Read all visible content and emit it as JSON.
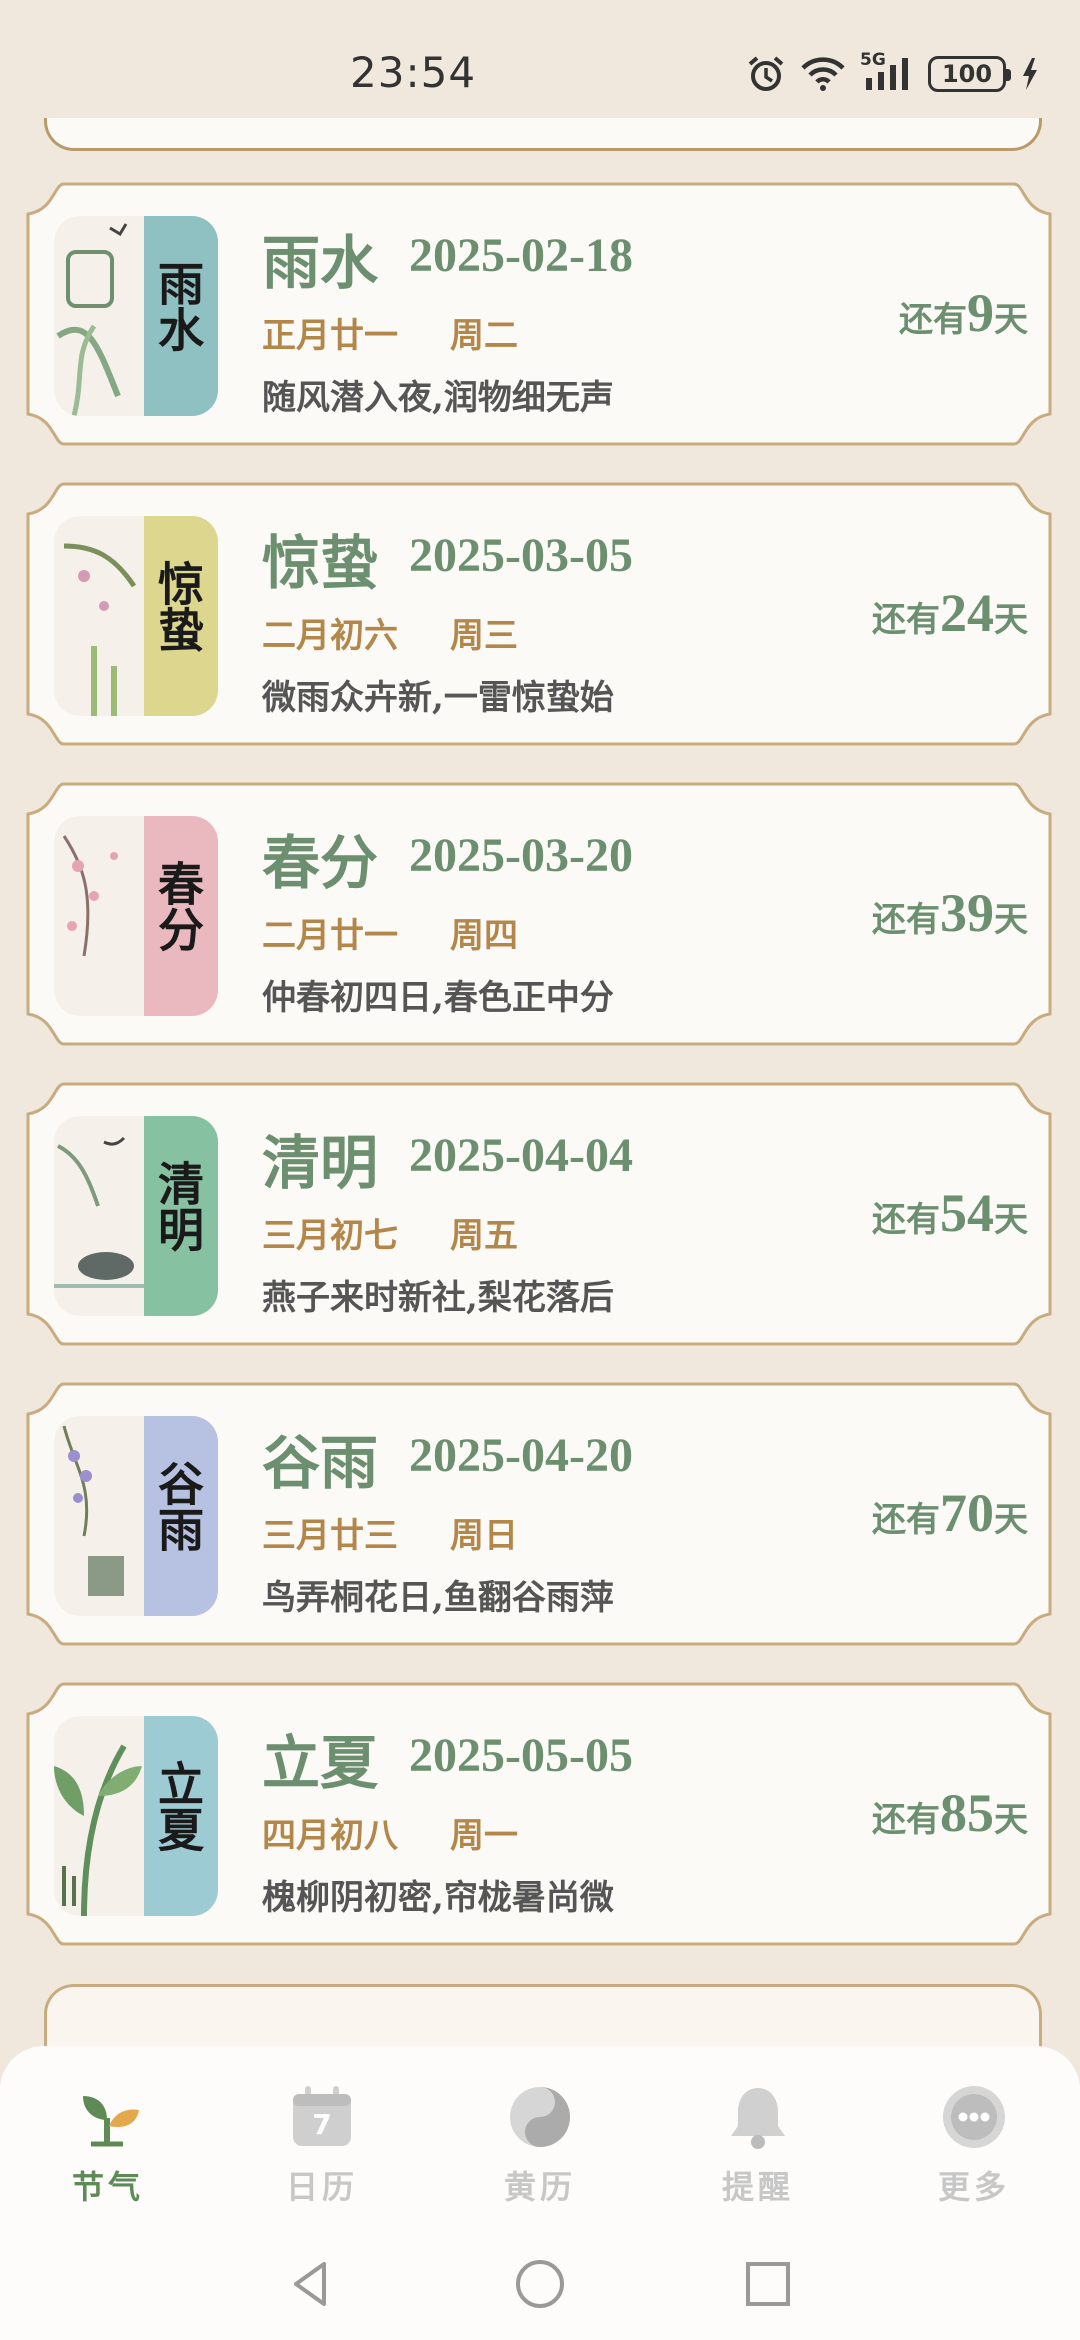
{
  "status": {
    "time": "23:54",
    "battery": "100",
    "network": "5G"
  },
  "terms": [
    {
      "name": "雨水",
      "date": "2025-02-18",
      "lunar": "正月廿一",
      "weekday": "周二",
      "poem": "随风潜入夜,润物细无声",
      "countdown_prefix": "还有",
      "days": "9",
      "countdown_suffix": "天",
      "calligraphy": "雨水",
      "band_color": "#8fc0c2"
    },
    {
      "name": "惊蛰",
      "date": "2025-03-05",
      "lunar": "二月初六",
      "weekday": "周三",
      "poem": "微雨众卉新,一雷惊蛰始",
      "countdown_prefix": "还有",
      "days": "24",
      "countdown_suffix": "天",
      "calligraphy": "惊蛰",
      "band_color": "#dcd68f"
    },
    {
      "name": "春分",
      "date": "2025-03-20",
      "lunar": "二月廿一",
      "weekday": "周四",
      "poem": "仲春初四日,春色正中分",
      "countdown_prefix": "还有",
      "days": "39",
      "countdown_suffix": "天",
      "calligraphy": "春分",
      "band_color": "#e9b9bf"
    },
    {
      "name": "清明",
      "date": "2025-04-04",
      "lunar": "三月初七",
      "weekday": "周五",
      "poem": "燕子来时新社,梨花落后",
      "countdown_prefix": "还有",
      "days": "54",
      "countdown_suffix": "天",
      "calligraphy": "清明",
      "band_color": "#86c2a2"
    },
    {
      "name": "谷雨",
      "date": "2025-04-20",
      "lunar": "三月廿三",
      "weekday": "周日",
      "poem": "鸟弄桐花日,鱼翻谷雨萍",
      "countdown_prefix": "还有",
      "days": "70",
      "countdown_suffix": "天",
      "calligraphy": "谷雨",
      "band_color": "#b7c1e2"
    },
    {
      "name": "立夏",
      "date": "2025-05-05",
      "lunar": "四月初八",
      "weekday": "周一",
      "poem": "槐柳阴初密,帘栊暑尚微",
      "countdown_prefix": "还有",
      "days": "85",
      "countdown_suffix": "天",
      "calligraphy": "立夏",
      "band_color": "#9dcbd4"
    }
  ],
  "nav": {
    "items": [
      {
        "label": "节气",
        "icon": "sprout-icon",
        "active": true
      },
      {
        "label": "日历",
        "icon": "calendar-icon",
        "active": false
      },
      {
        "label": "黄历",
        "icon": "taiji-icon",
        "active": false
      },
      {
        "label": "提醒",
        "icon": "bell-icon",
        "active": false
      },
      {
        "label": "更多",
        "icon": "more-icon",
        "active": false
      }
    ],
    "calendar_day": "7"
  },
  "colors": {
    "accent": "#6b8f6f",
    "gold": "#b3864a",
    "border": "#c8ac80",
    "background": "#f0e8dc"
  }
}
